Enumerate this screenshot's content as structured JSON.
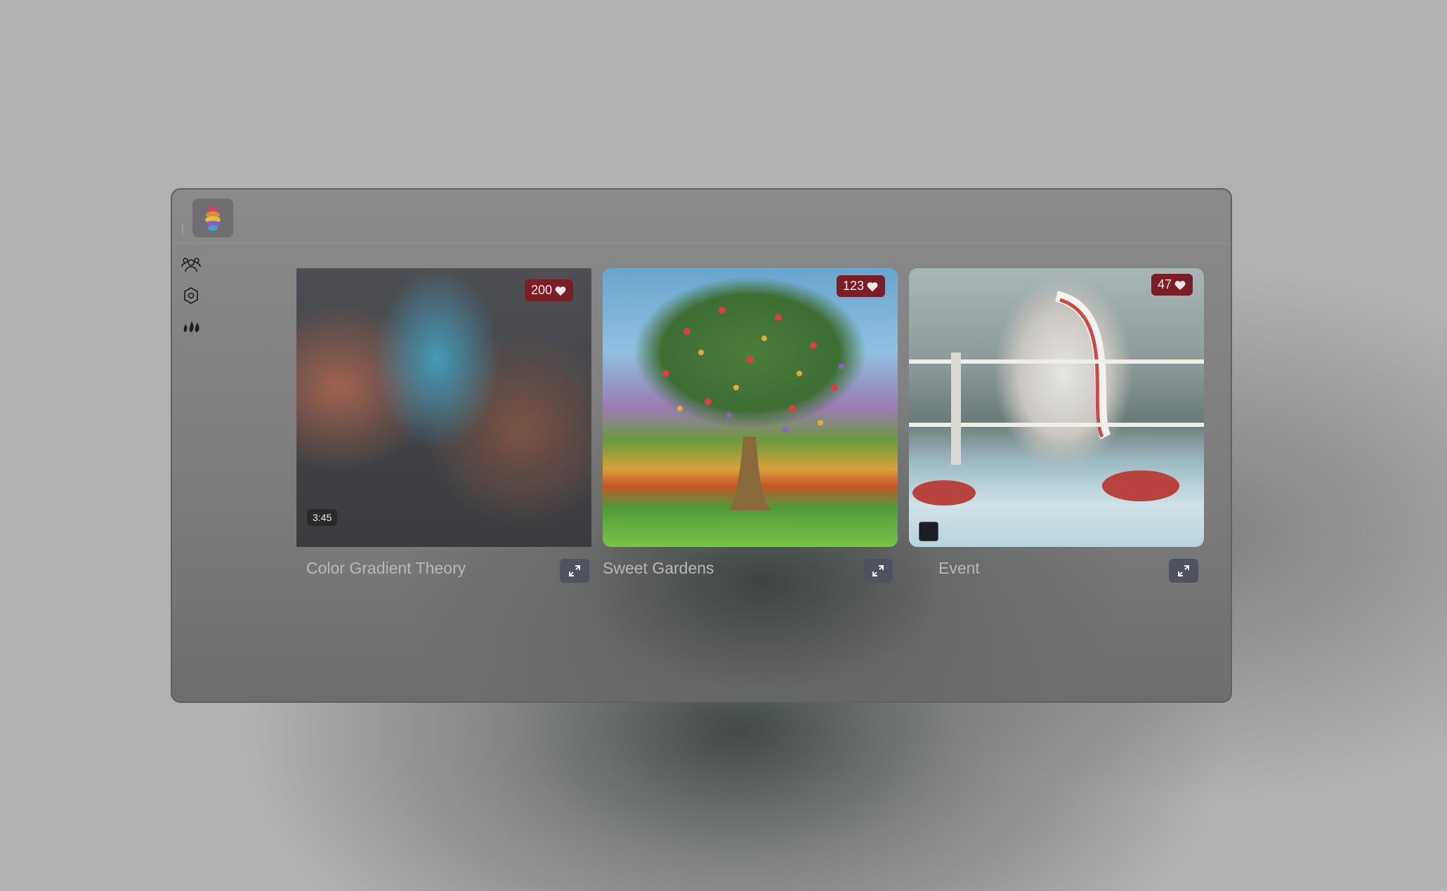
{
  "cards": [
    {
      "title": "Color Gradient Theory",
      "likes": "200",
      "duration": "3:45"
    },
    {
      "title": "Sweet Gardens",
      "likes": "123"
    },
    {
      "title": "Event",
      "likes": "47"
    }
  ],
  "sidebar": {
    "items": [
      {
        "icon": "users-icon"
      },
      {
        "icon": "settings-hexagon-icon"
      },
      {
        "icon": "flames-icon"
      }
    ]
  },
  "colors": {
    "like_badge": "#7a1d27",
    "expand_button": "#4f5360"
  }
}
